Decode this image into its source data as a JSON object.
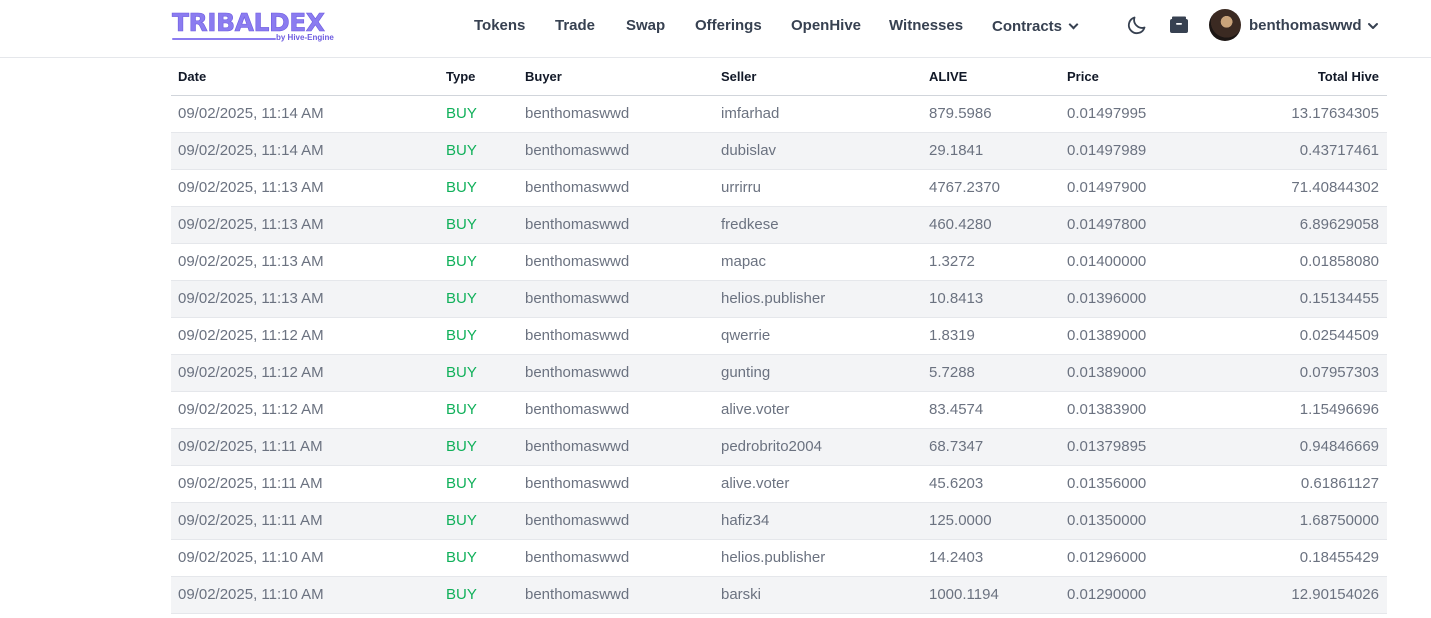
{
  "brand": {
    "name": "TRIBALDEX",
    "sub": "by Hive-Engine",
    "color": "#8b7cf0"
  },
  "nav": {
    "tokens": "Tokens",
    "trade": "Trade",
    "swap": "Swap",
    "offerings": "Offerings",
    "openhive": "OpenHive",
    "witnesses": "Witnesses",
    "contracts": "Contracts"
  },
  "user": {
    "name": "benthomaswwd"
  },
  "icons": {
    "theme": "moon-icon",
    "wallet": "wallet-icon",
    "dropdown": "chevron-down-icon"
  },
  "table": {
    "headers": {
      "date": "Date",
      "type": "Type",
      "buyer": "Buyer",
      "seller": "Seller",
      "alive": "ALIVE",
      "price": "Price",
      "total": "Total Hive"
    },
    "rows": [
      {
        "date": "09/02/2025, 11:14 AM",
        "type": "BUY",
        "buyer": "benthomaswwd",
        "seller": "imfarhad",
        "alive": "879.5986",
        "price": "0.01497995",
        "total": "13.17634305"
      },
      {
        "date": "09/02/2025, 11:14 AM",
        "type": "BUY",
        "buyer": "benthomaswwd",
        "seller": "dubislav",
        "alive": "29.1841",
        "price": "0.01497989",
        "total": "0.43717461"
      },
      {
        "date": "09/02/2025, 11:13 AM",
        "type": "BUY",
        "buyer": "benthomaswwd",
        "seller": "urrirru",
        "alive": "4767.2370",
        "price": "0.01497900",
        "total": "71.40844302"
      },
      {
        "date": "09/02/2025, 11:13 AM",
        "type": "BUY",
        "buyer": "benthomaswwd",
        "seller": "fredkese",
        "alive": "460.4280",
        "price": "0.01497800",
        "total": "6.89629058"
      },
      {
        "date": "09/02/2025, 11:13 AM",
        "type": "BUY",
        "buyer": "benthomaswwd",
        "seller": "mapac",
        "alive": "1.3272",
        "price": "0.01400000",
        "total": "0.01858080"
      },
      {
        "date": "09/02/2025, 11:13 AM",
        "type": "BUY",
        "buyer": "benthomaswwd",
        "seller": "helios.publisher",
        "alive": "10.8413",
        "price": "0.01396000",
        "total": "0.15134455"
      },
      {
        "date": "09/02/2025, 11:12 AM",
        "type": "BUY",
        "buyer": "benthomaswwd",
        "seller": "qwerrie",
        "alive": "1.8319",
        "price": "0.01389000",
        "total": "0.02544509"
      },
      {
        "date": "09/02/2025, 11:12 AM",
        "type": "BUY",
        "buyer": "benthomaswwd",
        "seller": "gunting",
        "alive": "5.7288",
        "price": "0.01389000",
        "total": "0.07957303"
      },
      {
        "date": "09/02/2025, 11:12 AM",
        "type": "BUY",
        "buyer": "benthomaswwd",
        "seller": "alive.voter",
        "alive": "83.4574",
        "price": "0.01383900",
        "total": "1.15496696"
      },
      {
        "date": "09/02/2025, 11:11 AM",
        "type": "BUY",
        "buyer": "benthomaswwd",
        "seller": "pedrobrito2004",
        "alive": "68.7347",
        "price": "0.01379895",
        "total": "0.94846669"
      },
      {
        "date": "09/02/2025, 11:11 AM",
        "type": "BUY",
        "buyer": "benthomaswwd",
        "seller": "alive.voter",
        "alive": "45.6203",
        "price": "0.01356000",
        "total": "0.61861127"
      },
      {
        "date": "09/02/2025, 11:11 AM",
        "type": "BUY",
        "buyer": "benthomaswwd",
        "seller": "hafiz34",
        "alive": "125.0000",
        "price": "0.01350000",
        "total": "1.68750000"
      },
      {
        "date": "09/02/2025, 11:10 AM",
        "type": "BUY",
        "buyer": "benthomaswwd",
        "seller": "helios.publisher",
        "alive": "14.2403",
        "price": "0.01296000",
        "total": "0.18455429"
      },
      {
        "date": "09/02/2025, 11:10 AM",
        "type": "BUY",
        "buyer": "benthomaswwd",
        "seller": "barski",
        "alive": "1000.1194",
        "price": "0.01290000",
        "total": "12.90154026"
      }
    ]
  }
}
